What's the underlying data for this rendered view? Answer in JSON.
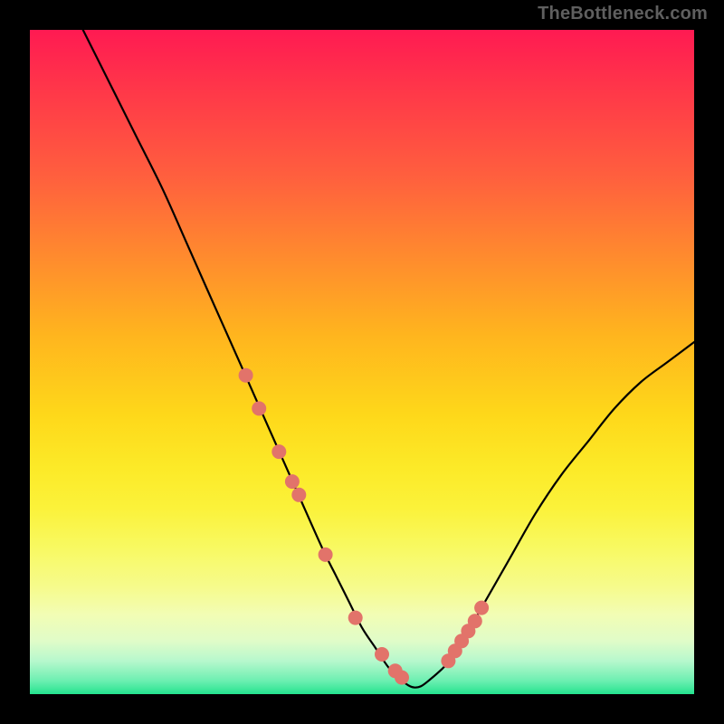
{
  "watermark": "TheBottleneck.com",
  "colors": {
    "marker": "#e2736a",
    "line": "#000000"
  },
  "chart_data": {
    "type": "line",
    "title": "",
    "xlabel": "",
    "ylabel": "",
    "xlim": [
      0,
      100
    ],
    "ylim": [
      0,
      100
    ],
    "x": [
      8,
      12,
      16,
      20,
      24,
      28,
      32,
      36,
      40,
      44,
      46,
      48,
      50,
      52,
      54,
      56,
      58,
      60,
      64,
      68,
      72,
      76,
      80,
      84,
      88,
      92,
      96,
      100
    ],
    "values": [
      100,
      92,
      84,
      76,
      67,
      58,
      49,
      40,
      31,
      22,
      18,
      14,
      10,
      7,
      4,
      2,
      1,
      2,
      6,
      13,
      20,
      27,
      33,
      38,
      43,
      47,
      50,
      53
    ],
    "markers_x": [
      32.5,
      34.5,
      37.5,
      39.5,
      40.5,
      44.5,
      49,
      53,
      55,
      56,
      63,
      64,
      65,
      66,
      67,
      68
    ],
    "markers_y": [
      48,
      43,
      36.5,
      32,
      30,
      21,
      11.5,
      6,
      3.5,
      2.5,
      5,
      6.5,
      8,
      9.5,
      11,
      13
    ]
  }
}
